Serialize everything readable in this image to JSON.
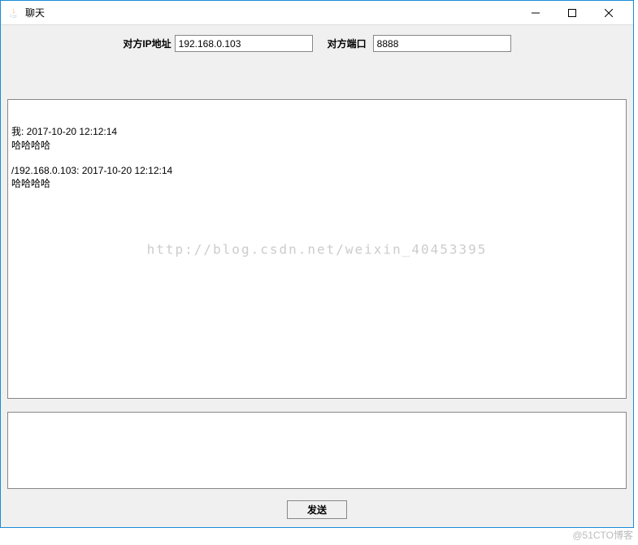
{
  "window": {
    "title": "聊天"
  },
  "form": {
    "ip_label": "对方IP地址",
    "ip_value": "192.168.0.103",
    "port_label": "对方端口",
    "port_value": "8888"
  },
  "chat": {
    "messages": [
      {
        "header": "我: 2017-10-20 12:12:14",
        "body": "哈哈哈哈"
      },
      {
        "header": "/192.168.0.103: 2017-10-20 12:12:14",
        "body": "哈哈哈哈"
      }
    ],
    "watermark": "http://blog.csdn.net/weixin_40453395"
  },
  "input": {
    "value": ""
  },
  "actions": {
    "send_label": "发送"
  },
  "attribution": "@51CTO博客"
}
